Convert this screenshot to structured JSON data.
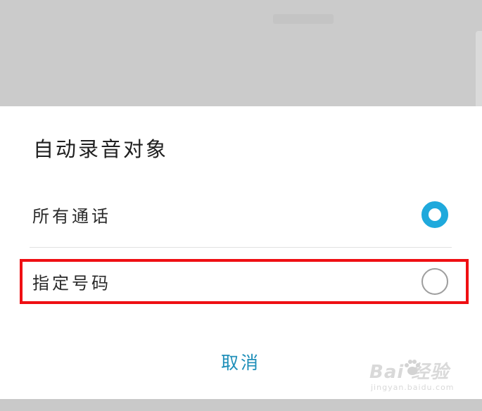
{
  "dialog": {
    "title": "自动录音对象",
    "options": [
      {
        "label": "所有通话",
        "selected": true
      },
      {
        "label": "指定号码",
        "selected": false
      }
    ],
    "cancel_label": "取消"
  },
  "colors": {
    "accent": "#1fa9dc",
    "cancel_text": "#1f8fb9",
    "highlight_border": "#ef0f13",
    "backdrop": "#cbcbcb"
  },
  "watermark": {
    "logo_text": "Bai 经验",
    "sub_text": "jingyan.baidu.com"
  }
}
